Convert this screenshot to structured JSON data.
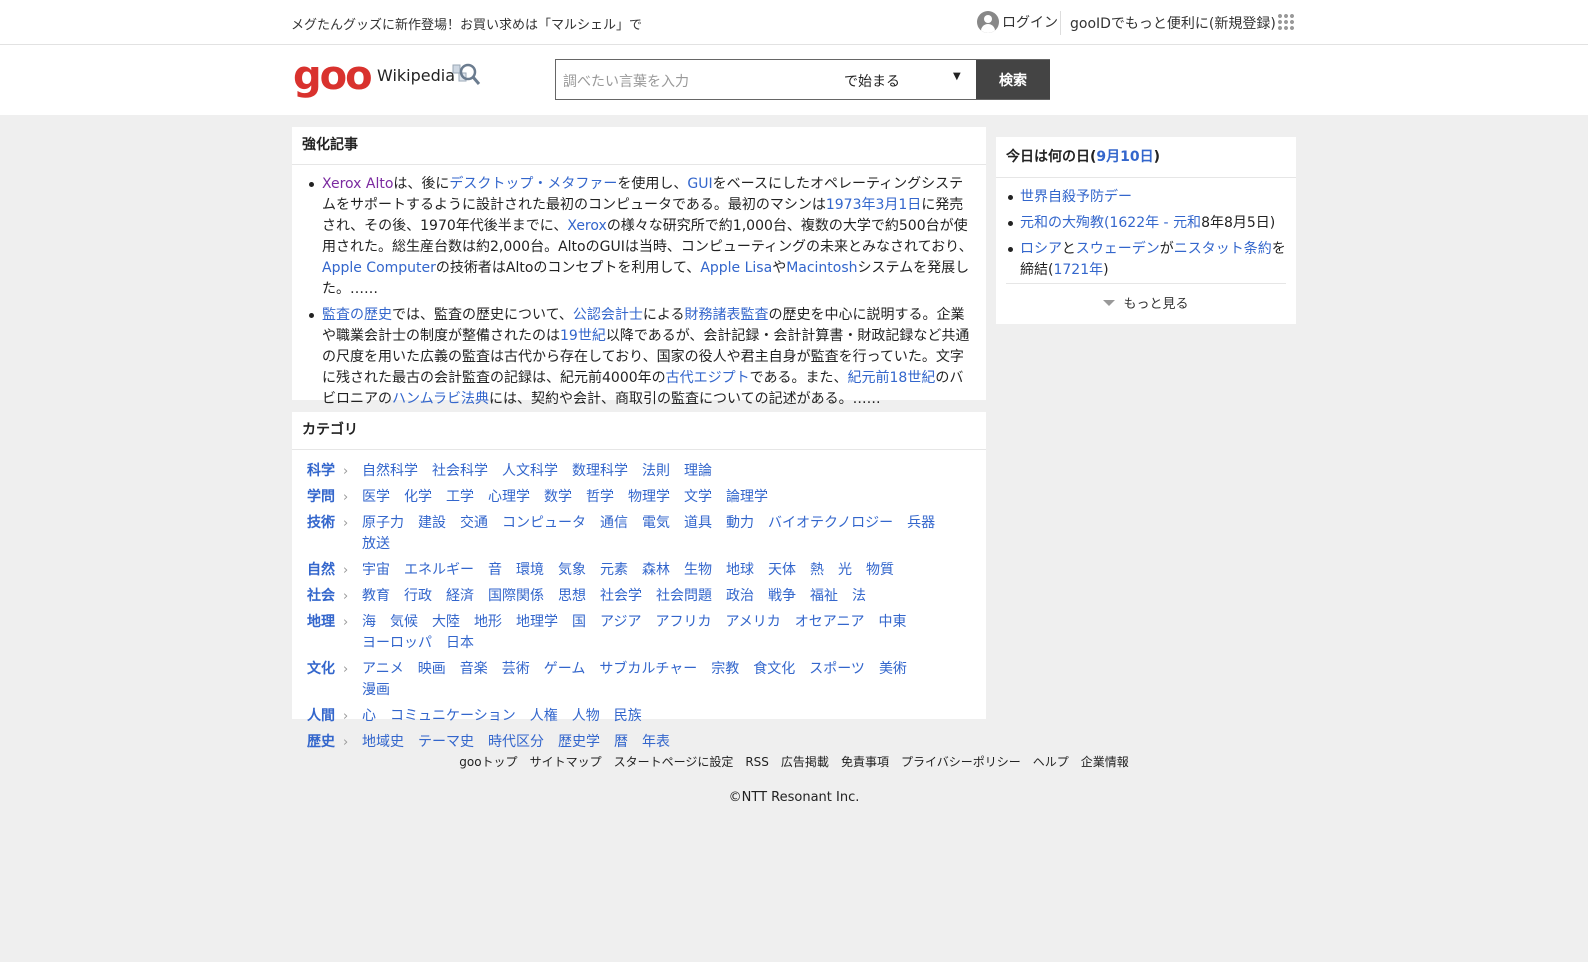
{
  "topbar": {
    "promo": "メグたんグッズに新作登場！お買い求めは「マルシェル」で",
    "login": "ログイン",
    "register": "gooIDでもっと便利に(新規登録)"
  },
  "header": {
    "logo": "goo",
    "section": "Wikipedia",
    "search_placeholder": "調べたい言葉を入力",
    "search_mode": "で始まる",
    "search_button": "検索"
  },
  "featured": {
    "title": "強化記事",
    "a1": [
      {
        "t": "Xerox Alto",
        "c": "visited"
      },
      {
        "t": "は、後に"
      },
      {
        "t": "デスクトップ・メタファー",
        "c": "lnk"
      },
      {
        "t": "を使用し、"
      },
      {
        "t": "GUI",
        "c": "lnk"
      },
      {
        "t": "をベースにしたオペレーティングシステムをサポートするように設計された最初のコンピュータである。最初のマシンは"
      },
      {
        "t": "1973年3月1日",
        "c": "lnk"
      },
      {
        "t": "に発売され、その後、1970年代後半までに、"
      },
      {
        "t": "Xerox",
        "c": "lnk"
      },
      {
        "t": "の様々な研究所で約1,000台、複数の大学で約500台が使用された。総生産台数は約2,000台。AltoのGUIは当時、コンピューティングの未来とみなされており、"
      },
      {
        "t": "Apple Computer",
        "c": "lnk"
      },
      {
        "t": "の技術者はAltoのコンセプトを利用して、"
      },
      {
        "t": "Apple Lisa",
        "c": "lnk"
      },
      {
        "t": "や"
      },
      {
        "t": "Macintosh",
        "c": "lnk"
      },
      {
        "t": "システムを発展した。……"
      }
    ],
    "a2": [
      {
        "t": "監査の歴史",
        "c": "lnk"
      },
      {
        "t": "では、監査の歴史について、"
      },
      {
        "t": "公認会計士",
        "c": "lnk"
      },
      {
        "t": "による"
      },
      {
        "t": "財務諸表監査",
        "c": "lnk"
      },
      {
        "t": "の歴史を中心に説明する。企業や職業会計士の制度が整備されたのは"
      },
      {
        "t": "19世紀",
        "c": "lnk"
      },
      {
        "t": "以降であるが、会計記録・会計計算書・財政記録など共通の尺度を用いた広義の監査は古代から存在しており、国家の役人や君主自身が監査を行っていた。文字に残された最古の会計監査の記録は、紀元前4000年の"
      },
      {
        "t": "古代エジプト",
        "c": "lnk"
      },
      {
        "t": "である。また、"
      },
      {
        "t": "紀元前18世紀",
        "c": "lnk"
      },
      {
        "t": "のバビロニアの"
      },
      {
        "t": "ハンムラビ法典",
        "c": "lnk"
      },
      {
        "t": "には、契約や会計、商取引の監査についての記述がある。……"
      }
    ]
  },
  "categories": {
    "title": "カテゴリ",
    "rows": [
      {
        "head": "科学",
        "items": [
          "自然科学",
          "社会科学",
          "人文科学",
          "数理科学",
          "法則",
          "理論"
        ]
      },
      {
        "head": "学問",
        "items": [
          "医学",
          "化学",
          "工学",
          "心理学",
          "数学",
          "哲学",
          "物理学",
          "文学",
          "論理学"
        ]
      },
      {
        "head": "技術",
        "items": [
          "原子力",
          "建設",
          "交通",
          "コンピュータ",
          "通信",
          "電気",
          "道具",
          "動力",
          "バイオテクノロジー",
          "兵器",
          "放送"
        ]
      },
      {
        "head": "自然",
        "items": [
          "宇宙",
          "エネルギー",
          "音",
          "環境",
          "気象",
          "元素",
          "森林",
          "生物",
          "地球",
          "天体",
          "熱",
          "光",
          "物質"
        ]
      },
      {
        "head": "社会",
        "items": [
          "教育",
          "行政",
          "経済",
          "国際関係",
          "思想",
          "社会学",
          "社会問題",
          "政治",
          "戦争",
          "福祉",
          "法"
        ]
      },
      {
        "head": "地理",
        "items": [
          "海",
          "気候",
          "大陸",
          "地形",
          "地理学",
          "国",
          "アジア",
          "アフリカ",
          "アメリカ",
          "オセアニア",
          "中東",
          "ヨーロッパ",
          "日本"
        ]
      },
      {
        "head": "文化",
        "items": [
          "アニメ",
          "映画",
          "音楽",
          "芸術",
          "ゲーム",
          "サブカルチャー",
          "宗教",
          "食文化",
          "スポーツ",
          "美術",
          "漫画"
        ]
      },
      {
        "head": "人間",
        "items": [
          "心",
          "コミュニケーション",
          "人権",
          "人物",
          "民族"
        ]
      },
      {
        "head": "歴史",
        "items": [
          "地域史",
          "テーマ史",
          "時代区分",
          "歴史学",
          "暦",
          "年表"
        ]
      }
    ]
  },
  "today": {
    "title_prefix": "今日は何の日(",
    "date": "9月10日",
    "title_suffix": ")",
    "items": [
      [
        {
          "t": "世界自殺予防デー",
          "c": "lnk"
        }
      ],
      [
        {
          "t": "元和の大殉教(",
          "c": "lnk"
        },
        {
          "t": "1622年",
          "c": "lnk"
        },
        {
          "t": " - ",
          "c": "lnk"
        },
        {
          "t": "元和",
          "c": "lnk"
        },
        {
          "t": "8年8月5日)"
        }
      ],
      [
        {
          "t": "ロシア",
          "c": "lnk"
        },
        {
          "t": "と"
        },
        {
          "t": "スウェーデン",
          "c": "lnk"
        },
        {
          "t": "が"
        },
        {
          "t": "ニスタット条約",
          "c": "lnk"
        },
        {
          "t": "を締結("
        },
        {
          "t": "1721年",
          "c": "lnk"
        },
        {
          "t": ")"
        }
      ]
    ],
    "more": "もっと見る"
  },
  "footer": {
    "links": [
      "gooトップ",
      "サイトマップ",
      "スタートページに設定",
      "RSS",
      "広告掲載",
      "免責事項",
      "プライバシーポリシー",
      "ヘルプ",
      "企業情報"
    ],
    "copyright": "©NTT Resonant Inc."
  },
  "colors": {
    "link": "#3366cc",
    "visited": "#7b2aa0",
    "logo": "#d9322e",
    "button": "#444444",
    "background": "#efefef"
  }
}
